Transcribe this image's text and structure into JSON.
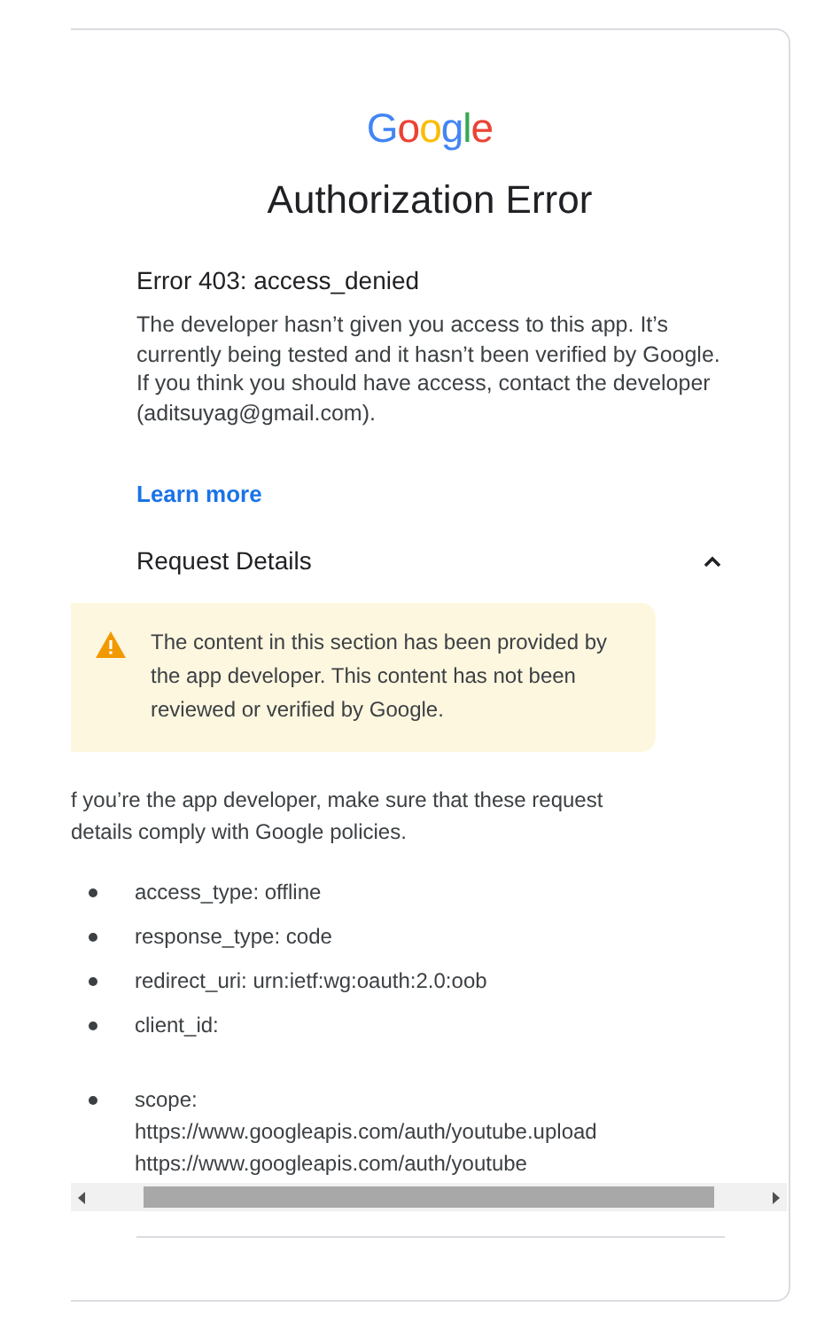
{
  "logo": {
    "letters": [
      {
        "char": "G",
        "color": "#4285f4"
      },
      {
        "char": "o",
        "color": "#ea4335"
      },
      {
        "char": "o",
        "color": "#fbbc05"
      },
      {
        "char": "g",
        "color": "#4285f4"
      },
      {
        "char": "l",
        "color": "#34a853"
      },
      {
        "char": "e",
        "color": "#ea4335"
      }
    ]
  },
  "title": "Authorization Error",
  "error_heading": "Error 403: access_denied",
  "message": "The developer hasn’t given you access to this app. It’s currently being tested and it hasn’t been verified by Google. If you think you should have access, contact the developer (aditsuyag@gmail.com).",
  "learn_more": "Learn more",
  "request_details": {
    "heading": "Request Details",
    "expanded": true,
    "warning": "The content in this section has been provided by the app developer. This content has not been reviewed or verified by Google.",
    "intro": "f you’re the app developer, make sure that these request details comply with Google policies.",
    "items": [
      {
        "lines": [
          "access_type: offline"
        ]
      },
      {
        "lines": [
          "response_type: code"
        ]
      },
      {
        "lines": [
          "redirect_uri: urn:ietf:wg:oauth:2.0:oob"
        ]
      },
      {
        "lines": [
          "client_id:"
        ],
        "gap_after": true
      },
      {
        "lines": [
          "scope:",
          "https://www.googleapis.com/auth/youtube.upload",
          "https://www.googleapis.com/auth/youtube"
        ]
      }
    ]
  }
}
